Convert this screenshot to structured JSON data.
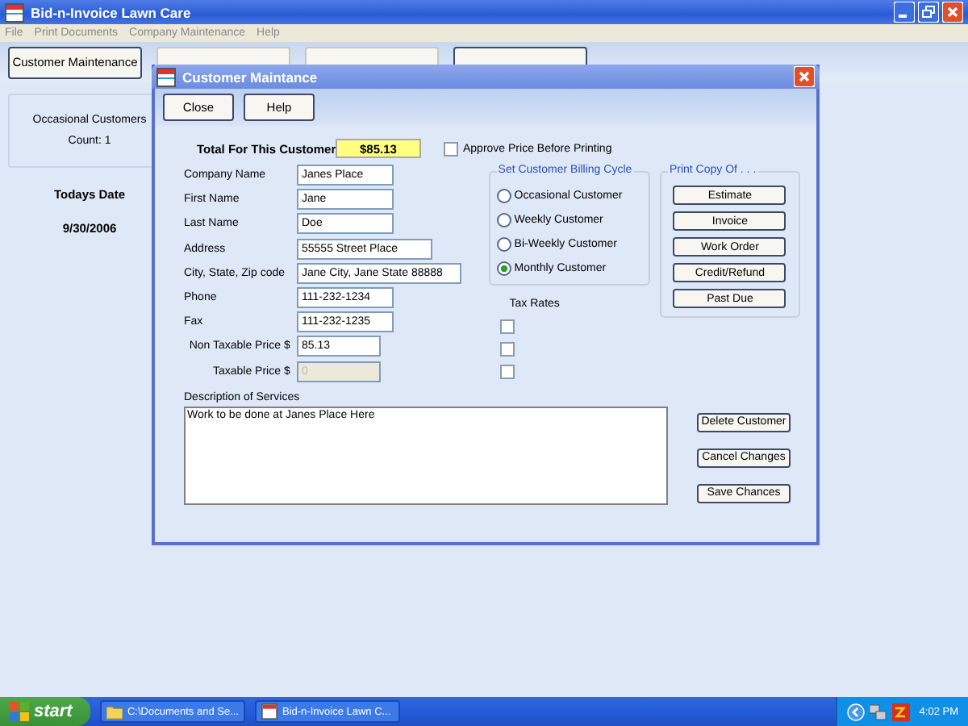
{
  "window": {
    "title": "Bid-n-Invoice Lawn Care"
  },
  "menu": [
    "File",
    "Print Documents",
    "Company Maintenance",
    "Help"
  ],
  "toolbar": [
    {
      "label": "Customer Maintenance",
      "disabled": false
    },
    {
      "disabled": true
    },
    {
      "disabled": true
    },
    {
      "disabled": false
    }
  ],
  "sidebar": {
    "group": "Occasional Customers",
    "count": "Count: 1",
    "date_label": "Todays Date",
    "date": "9/30/2006"
  },
  "dialog": {
    "title": "Customer Maintance",
    "buttons": [
      "Close",
      "Help"
    ],
    "total_label": "Total For This Customer",
    "total": "$85.13",
    "approve": {
      "label": "Approve Price Before Printing",
      "checked": false
    },
    "fields": [
      {
        "label": "Company Name",
        "value": "Janes Place",
        "kind": "text",
        "disabled": false
      },
      {
        "label": "First Name",
        "value": "Jane",
        "kind": "text",
        "disabled": false
      },
      {
        "label": "Last Name",
        "value": "Doe",
        "kind": "text",
        "disabled": false
      },
      {
        "label": "Address",
        "value": "55555 Street Place",
        "kind": "text",
        "disabled": false
      },
      {
        "label": "City, State, Zip code",
        "value": "Jane City, Jane State 88888",
        "kind": "text",
        "disabled": false
      },
      {
        "label": "Phone",
        "value": "111-232-1234",
        "kind": "text",
        "disabled": false
      },
      {
        "label": "Fax",
        "value": "111-232-1235",
        "kind": "text",
        "disabled": false
      },
      {
        "label": "Non Taxable Price",
        "currency": "$",
        "value": "85.13",
        "kind": "price",
        "disabled": false
      },
      {
        "label": "Taxable Price",
        "currency": "$",
        "value": "0",
        "kind": "price",
        "disabled": true
      }
    ],
    "billing": {
      "title": "Set Customer Billing Cycle",
      "options": [
        {
          "label": "Occasional Customer",
          "selected": false
        },
        {
          "label": "Weekly Customer",
          "selected": false
        },
        {
          "label": "Bi-Weekly Customer",
          "selected": false
        },
        {
          "label": "Monthly Customer",
          "selected": true
        }
      ]
    },
    "tax": {
      "title": "Tax Rates",
      "boxes": [
        {
          "checked": false
        },
        {
          "checked": false
        },
        {
          "checked": false
        }
      ]
    },
    "print": {
      "title": "Print Copy Of . . .",
      "buttons": [
        "Estimate",
        "Invoice",
        "Work Order",
        "Credit/Refund",
        "Past Due"
      ]
    },
    "description": {
      "label": "Description of Services",
      "value": "Work to be done at Janes Place Here"
    },
    "actions": [
      "Delete Customer",
      "Cancel Changes",
      "Save Chances"
    ]
  },
  "taskbar": {
    "start": "start",
    "tasks": [
      {
        "label": "C:\\Documents and Se...",
        "kind": "folder"
      },
      {
        "label": "Bid-n-Invoice Lawn C...",
        "kind": "app"
      }
    ],
    "time": "4:02 PM"
  }
}
